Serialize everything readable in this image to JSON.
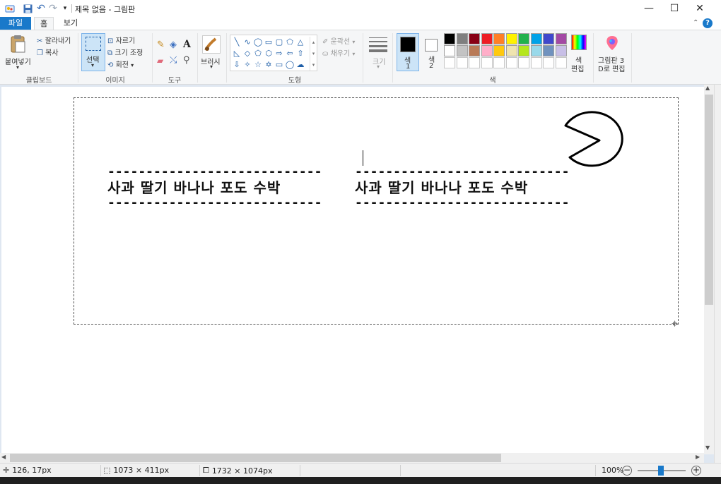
{
  "window": {
    "title": "제목 없음 - 그림판",
    "minimize": "—",
    "maximize": "☐",
    "close": "✕"
  },
  "tabs": {
    "file": "파일",
    "home": "홈",
    "view": "보기"
  },
  "ribbon": {
    "clipboard": {
      "paste": "붙여넣기",
      "cut": "잘라내기",
      "copy": "복사",
      "label": "클립보드"
    },
    "image": {
      "select": "선택",
      "crop": "자르기",
      "resize": "크기 조정",
      "rotate": "회전",
      "label": "이미지"
    },
    "tools": {
      "label": "도구"
    },
    "brushes": {
      "label": "브러시"
    },
    "shapes": {
      "outline": "윤곽선",
      "fill": "채우기",
      "label": "도형"
    },
    "size": {
      "label": "크기"
    },
    "colors": {
      "color1": "색\n1",
      "color1_line1": "색",
      "color1_line2": "1",
      "color2_line1": "색",
      "color2_line2": "2",
      "edit_line1": "색",
      "edit_line2": "편집",
      "label": "색",
      "palette_row1": [
        "#000000",
        "#7f7f7f",
        "#880015",
        "#ed1c24",
        "#ff7f27",
        "#fff200",
        "#22b14c",
        "#00a2e8",
        "#3f48cc",
        "#a349a4"
      ],
      "palette_row2": [
        "#ffffff",
        "#c3c3c3",
        "#b97a57",
        "#ffaec9",
        "#ffc90e",
        "#efe4b0",
        "#b5e61d",
        "#99d9ea",
        "#7092be",
        "#c8bfe7"
      ]
    },
    "paint3d": {
      "line1": "그림판 3",
      "line2": "D로 편집"
    }
  },
  "canvas": {
    "dash_text": "----------------------------",
    "fruit_text": "사과 딸기 바나나 포도 수박"
  },
  "status": {
    "cursor_pos": "126, 17px",
    "selection_size": "1073 × 411px",
    "image_size": "1732 × 1074px",
    "zoom": "100%"
  }
}
